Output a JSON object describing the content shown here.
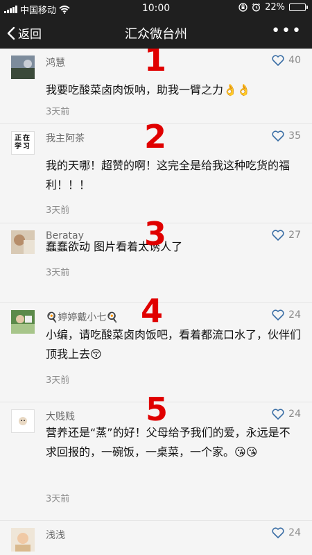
{
  "status": {
    "carrier": "中国移动",
    "time": "10:00",
    "battery_text": "22%",
    "battery_level": 0.22
  },
  "nav": {
    "back_label": "返回",
    "title": "汇众微台州",
    "more_icon": "more-icon"
  },
  "comments": [
    {
      "nick": "鸿慧",
      "likes": "40",
      "text": "我要吃酸菜卤肉饭呐，助我一臂之力👌👌",
      "time": "3天前",
      "marker": "1"
    },
    {
      "nick": "我主阿茶",
      "likes": "35",
      "text": "我的天哪！超赞的啊！这完全是给我这种吃货的福利！！！",
      "time": "3天前",
      "marker": "2",
      "avatar_text": "正在学习"
    },
    {
      "nick": "Beratay",
      "likes": "27",
      "text": "蠢蠢欲动 图片看着太诱人了",
      "time": "3天前",
      "marker": "3"
    },
    {
      "nick": "🍳婷婷戴小七🍳",
      "likes": "24",
      "text": "小编，请吃酸菜卤肉饭吧，看着都流口水了，伙伴们顶我上去😚",
      "time": "3天前",
      "marker": "4"
    },
    {
      "nick": "大贱贱",
      "likes": "24",
      "text": "营养还是“蒸”的好！父母给予我们的爱，永远是不求回报的，一碗饭，一桌菜，一个家。😘😘",
      "time": "3天前",
      "marker": "5"
    },
    {
      "nick": "浅浅",
      "likes": "24",
      "text": "",
      "time": "",
      "marker": ""
    }
  ]
}
